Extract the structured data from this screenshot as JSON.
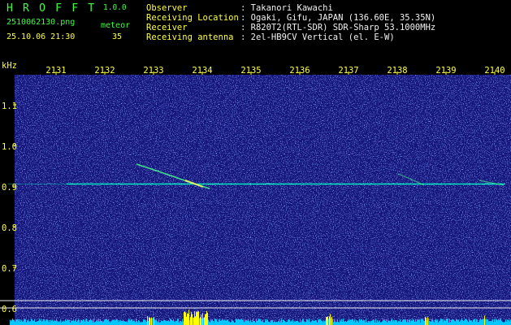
{
  "header": {
    "app_name": "H R O F F T",
    "version": "1.0.0",
    "filename": "2510062130.png",
    "meteor_label": "meteor",
    "datetime": "25.10.06 21:30",
    "meteor_count": "35"
  },
  "station": {
    "fields": [
      {
        "label": "Observer",
        "value": ": Takanori Kawachi"
      },
      {
        "label": "Receiving Location",
        "value": ": Ogaki, Gifu, JAPAN (136.60E, 35.35N)"
      },
      {
        "label": "Receiver",
        "value": ": R820T2(RTL-SDR) SDR-Sharp 53.1000MHz"
      },
      {
        "label": "Receiving antenna",
        "value": ": 2el-HB9CV Vertical (el. E-W)"
      }
    ]
  },
  "chart_data": {
    "type": "heatmap",
    "ylabel": "kHz",
    "x_ticks": [
      "2131",
      "2132",
      "2133",
      "2134",
      "2135",
      "2136",
      "2137",
      "2138",
      "2139",
      "2140"
    ],
    "y_ticks": [
      "1.1",
      "1.0",
      "0.9",
      "0.8",
      "0.7",
      "0.6"
    ],
    "ylim": [
      0.58,
      1.18
    ],
    "carrier_khz": 0.905,
    "colors": {
      "background": "#14147a",
      "noise": "#3a5cff",
      "signal": "#00ffc8",
      "axis_text": "#ffff3c",
      "level_low": "#00c8ff",
      "level_high": "#ffff00"
    }
  }
}
